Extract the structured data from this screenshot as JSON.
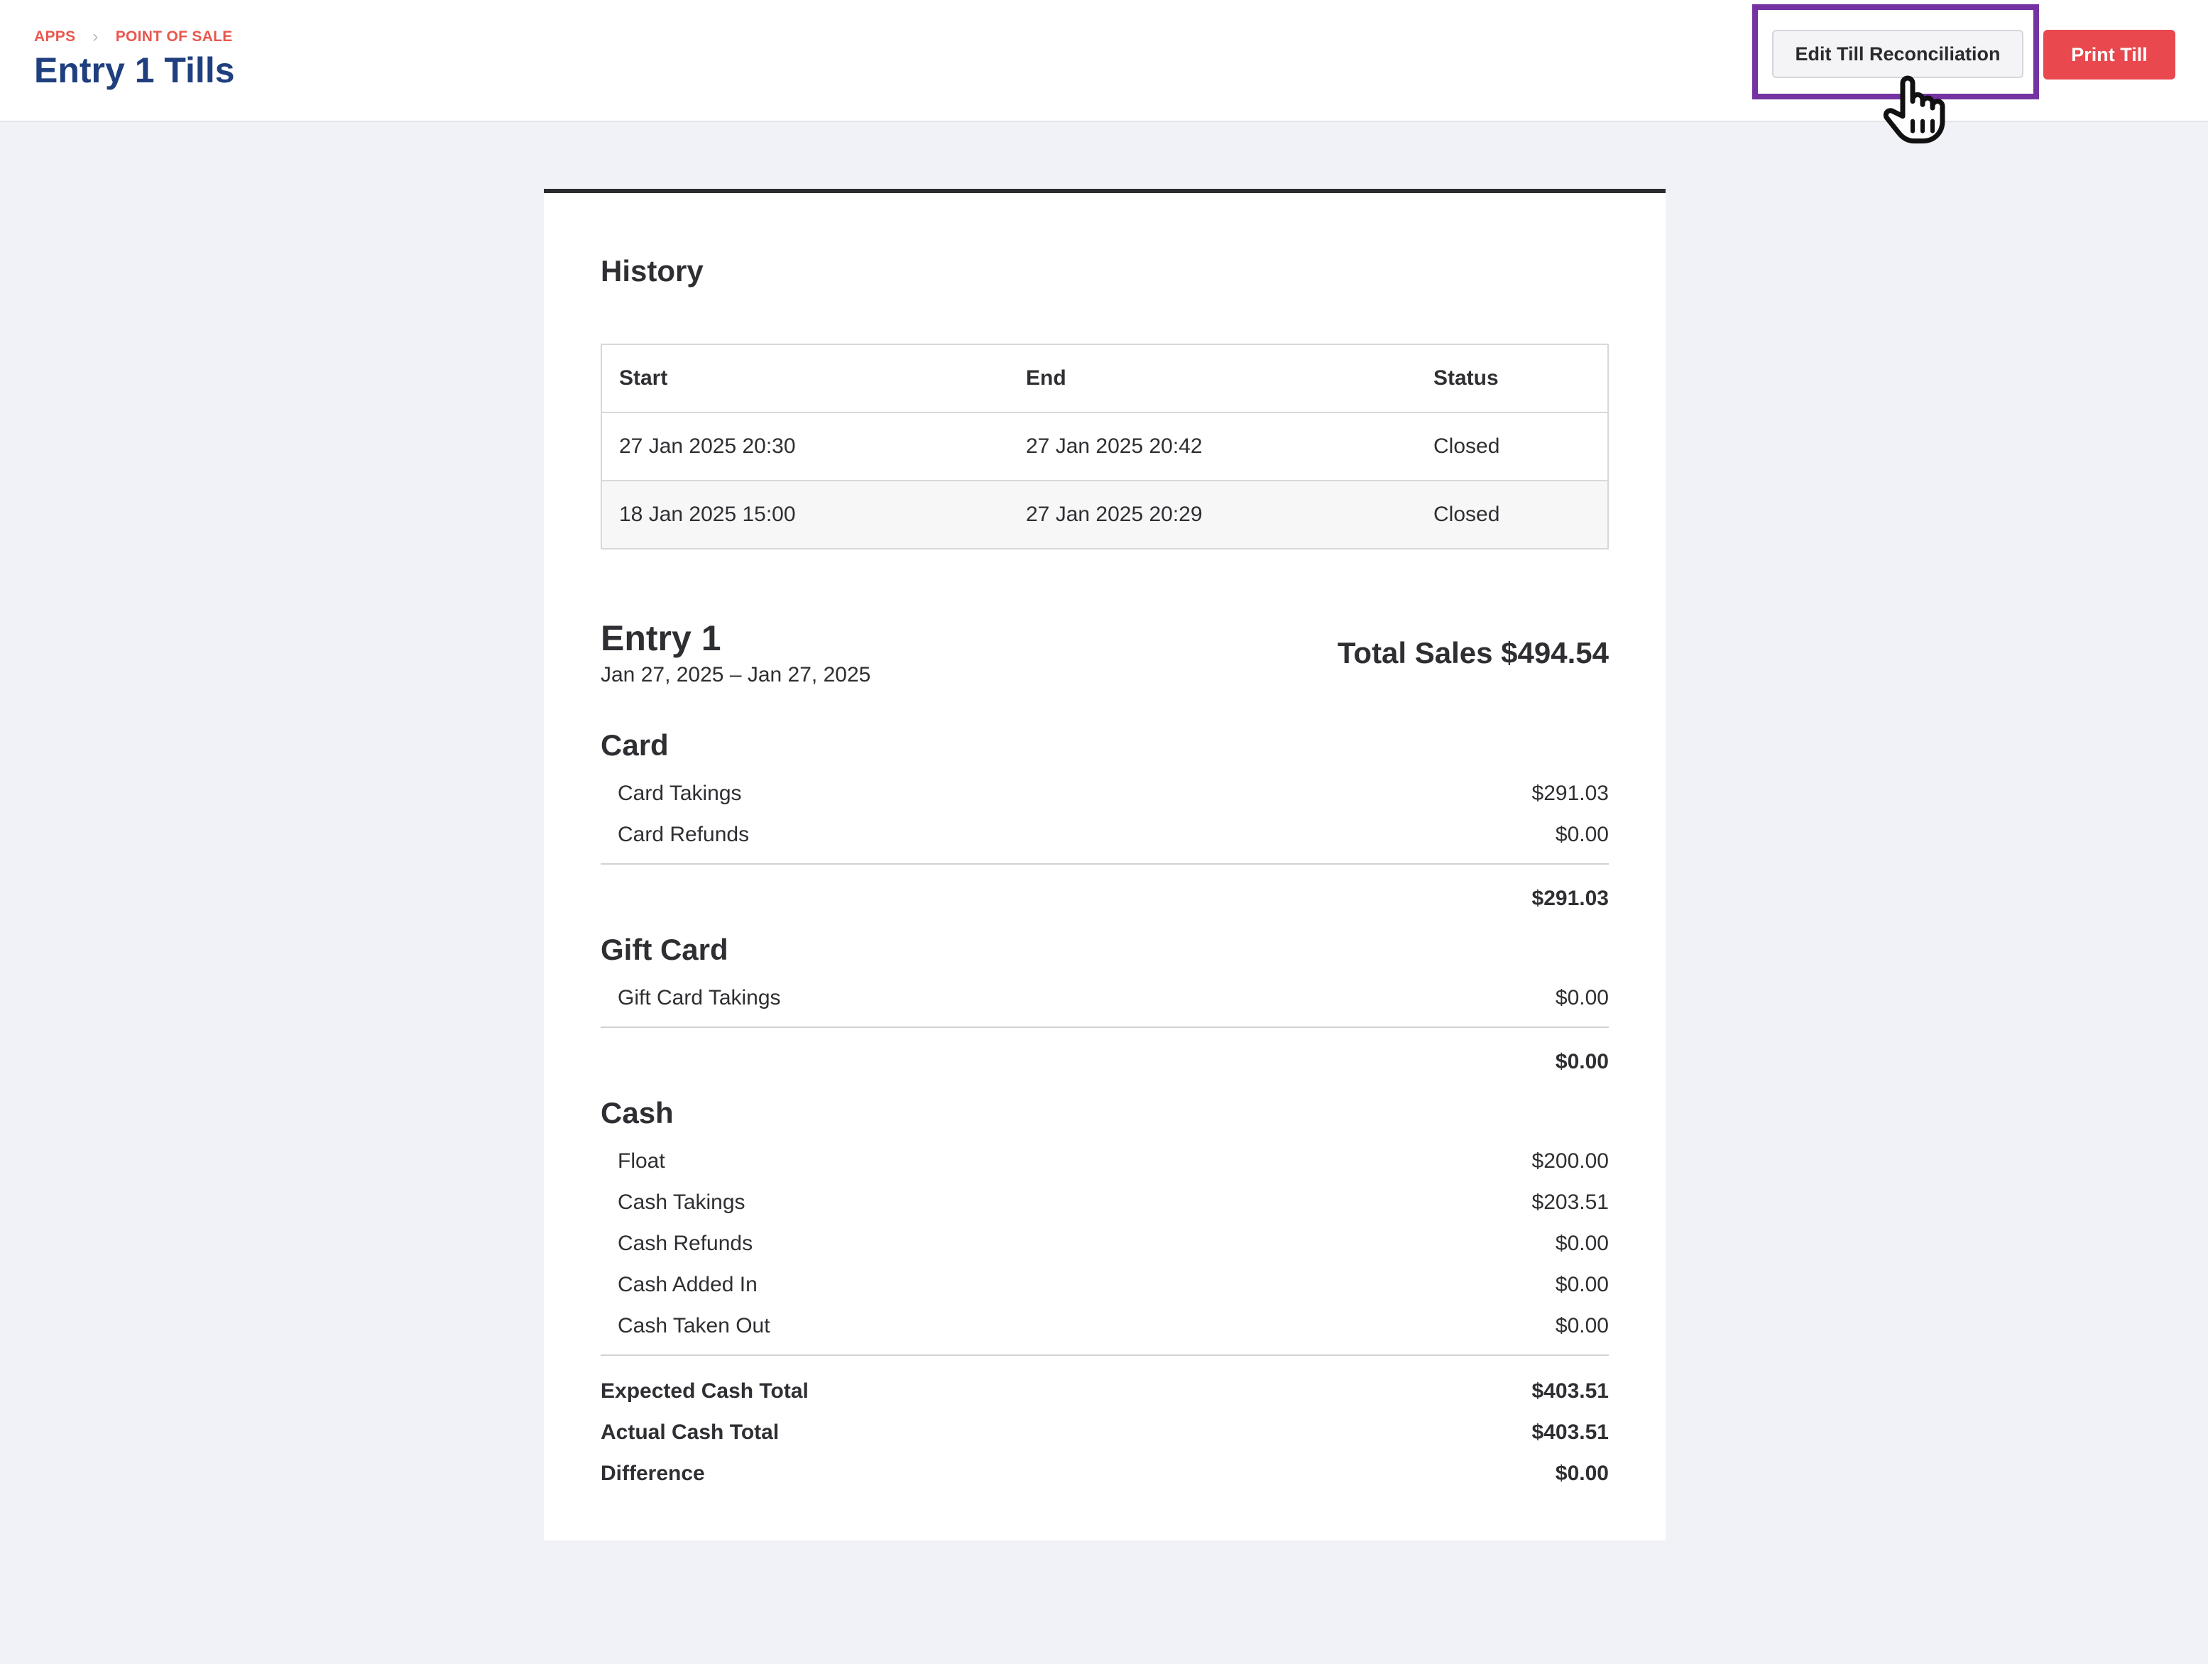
{
  "breadcrumb": {
    "apps": "APPS",
    "section": "POINT OF SALE"
  },
  "page": {
    "title": "Entry 1 Tills"
  },
  "actions": {
    "edit_label": "Edit Till Reconciliation",
    "print_label": "Print Till"
  },
  "history": {
    "heading": "History",
    "columns": [
      "Start",
      "End",
      "Status"
    ],
    "rows": [
      {
        "start": "27 Jan 2025 20:30",
        "end": "27 Jan 2025 20:42",
        "status": "Closed"
      },
      {
        "start": "18 Jan 2025 15:00",
        "end": "27 Jan 2025 20:29",
        "status": "Closed"
      }
    ]
  },
  "summary": {
    "entry_name": "Entry 1",
    "date_range": "Jan 27, 2025 – Jan 27, 2025",
    "total_sales": "Total Sales $494.54"
  },
  "card": {
    "title": "Card",
    "lines": [
      {
        "label": "Card Takings",
        "value": "$291.03"
      },
      {
        "label": "Card Refunds",
        "value": "$0.00"
      }
    ],
    "total": "$291.03"
  },
  "gift_card": {
    "title": "Gift Card",
    "lines": [
      {
        "label": "Gift Card Takings",
        "value": "$0.00"
      }
    ],
    "total": "$0.00"
  },
  "cash": {
    "title": "Cash",
    "lines": [
      {
        "label": "Float",
        "value": "$200.00"
      },
      {
        "label": "Cash Takings",
        "value": "$203.51"
      },
      {
        "label": "Cash Refunds",
        "value": "$0.00"
      },
      {
        "label": "Cash Added In",
        "value": "$0.00"
      },
      {
        "label": "Cash Taken Out",
        "value": "$0.00"
      }
    ],
    "totals": [
      {
        "label": "Expected Cash Total",
        "value": "$403.51"
      },
      {
        "label": "Actual Cash Total",
        "value": "$403.51"
      },
      {
        "label": "Difference",
        "value": "$0.00"
      }
    ]
  },
  "colors": {
    "brand_blue": "#1f3f7e",
    "accent_red": "#e9484e",
    "breadcrumb_red": "#e8584f",
    "highlight_purple": "#7433a0"
  },
  "icons": {
    "cursor": "hand-pointer-icon",
    "breadcrumb_separator": "chevron-right-icon"
  }
}
